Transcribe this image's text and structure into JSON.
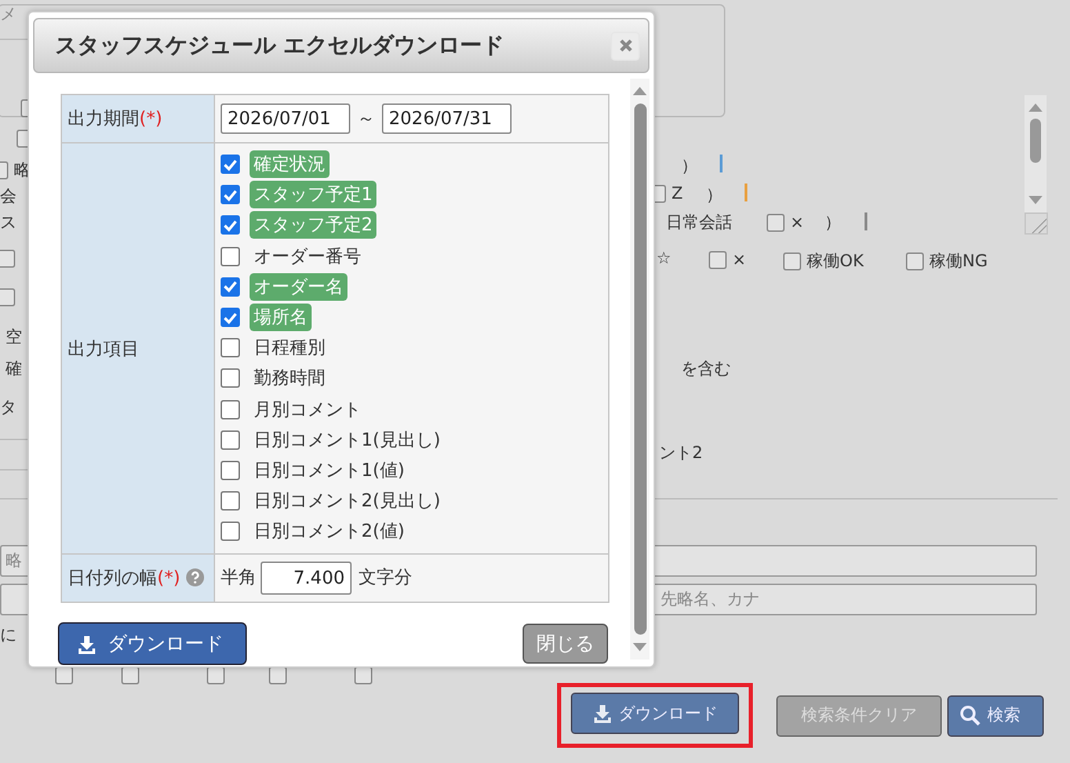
{
  "background": {
    "tab_label": "メ",
    "fragments": [
      {
        "kind": "check",
        "checked": false
      },
      {
        "kind": "check",
        "checked": false
      },
      {
        "kind": "check",
        "checked": false,
        "label": "略"
      },
      {
        "kind": "text",
        "label": "会"
      },
      {
        "kind": "text",
        "label": "ス"
      },
      {
        "kind": "check",
        "checked": false
      },
      {
        "kind": "check",
        "checked": false
      },
      {
        "kind": "text",
        "label": "空"
      },
      {
        "kind": "text",
        "label": "確"
      },
      {
        "kind": "text",
        "label": "タ"
      },
      {
        "kind": "text",
        "label": "に"
      },
      {
        "kind": "text",
        "label": "）"
      },
      {
        "kind": "bar",
        "color": "#5b9bd5"
      },
      {
        "kind": "check",
        "checked": false,
        "label": "Z"
      },
      {
        "kind": "text",
        "label": "）"
      },
      {
        "kind": "bar",
        "color": "#e8a040"
      },
      {
        "kind": "text",
        "label": "日常会話"
      },
      {
        "kind": "check",
        "checked": false,
        "label": "×"
      },
      {
        "kind": "text",
        "label": "）"
      },
      {
        "kind": "bar",
        "color": "#8a8a8a"
      },
      {
        "kind": "text",
        "label": "☆"
      },
      {
        "kind": "check",
        "checked": false,
        "label": "×"
      },
      {
        "kind": "check",
        "checked": false,
        "label": "稼働OK"
      },
      {
        "kind": "check",
        "checked": false,
        "label": "稼働NG"
      },
      {
        "kind": "text",
        "label": "を含む"
      },
      {
        "kind": "text",
        "label": "ント2"
      },
      {
        "kind": "check",
        "checked": false
      },
      {
        "kind": "check",
        "checked": false
      },
      {
        "kind": "check",
        "checked": false
      },
      {
        "kind": "check",
        "checked": false
      },
      {
        "kind": "check",
        "checked": false
      }
    ],
    "fields": [
      {
        "placeholder": "略"
      },
      {
        "placeholder": "先略名、カナ"
      }
    ],
    "actions": [
      {
        "label": "ダウンロード",
        "kind": "download",
        "highlighted": true
      },
      {
        "label": "検索条件クリア",
        "kind": "clear",
        "highlighted": false
      },
      {
        "label": "検索",
        "kind": "search",
        "highlighted": false
      }
    ]
  },
  "dialog": {
    "title": "スタッフスケジュール エクセルダウンロード",
    "period": {
      "label": "出力期間",
      "required_mark": "(*)",
      "start": "2026/07/01",
      "separator": "～",
      "end": "2026/07/31"
    },
    "items": {
      "label": "出力項目",
      "options": [
        {
          "label": "確定状況",
          "checked": true
        },
        {
          "label": "スタッフ予定1",
          "checked": true
        },
        {
          "label": "スタッフ予定2",
          "checked": true
        },
        {
          "label": "オーダー番号",
          "checked": false
        },
        {
          "label": "オーダー名",
          "checked": true
        },
        {
          "label": "場所名",
          "checked": true
        },
        {
          "label": "日程種別",
          "checked": false
        },
        {
          "label": "勤務時間",
          "checked": false
        },
        {
          "label": "月別コメント",
          "checked": false
        },
        {
          "label": "日別コメント1(見出し)",
          "checked": false
        },
        {
          "label": "日別コメント1(値)",
          "checked": false
        },
        {
          "label": "日別コメント2(見出し)",
          "checked": false
        },
        {
          "label": "日別コメント2(値)",
          "checked": false
        }
      ]
    },
    "width": {
      "label": "日付列の幅",
      "required_mark": "(*)",
      "prefix": "半角",
      "value": "7.400",
      "suffix": "文字分"
    },
    "buttons": [
      {
        "label": "ダウンロード",
        "kind": "primary"
      },
      {
        "label": "閉じる",
        "kind": "secondary"
      }
    ]
  }
}
